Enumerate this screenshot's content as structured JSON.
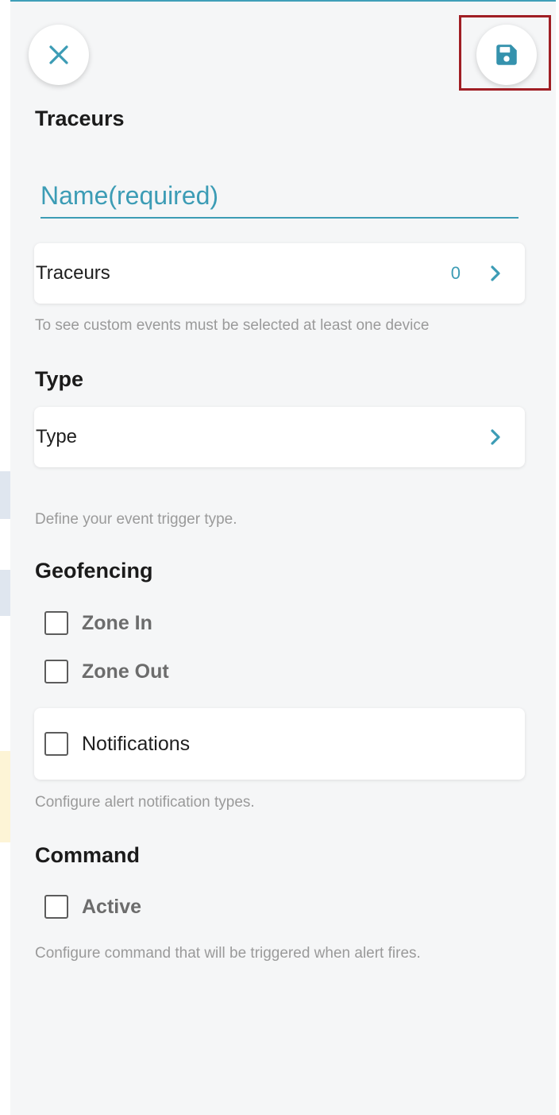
{
  "header": {
    "close_icon": "close-icon",
    "save_icon": "floppy-disk-save-icon"
  },
  "sections": {
    "trackers_heading": "Traceurs",
    "type_heading": "Type",
    "geofencing_heading": "Geofencing",
    "command_heading": "Command"
  },
  "name_input": {
    "placeholder": "Name(required)",
    "value": ""
  },
  "trackers_card": {
    "label": "Traceurs",
    "count": "0",
    "hint": "To see custom events must be selected at least one device"
  },
  "type_card": {
    "label": "Type",
    "hint": "Define your event trigger type."
  },
  "geofencing": {
    "options": [
      {
        "label": "Zone In",
        "checked": false
      },
      {
        "label": "Zone Out",
        "checked": false
      }
    ]
  },
  "notifications_card": {
    "label": "Notifications",
    "checked": false,
    "hint": "Configure alert notification types."
  },
  "command": {
    "active_label": "Active",
    "checked": false,
    "hint": "Configure command that will be triggered when alert fires."
  },
  "colors": {
    "accent": "#3c9cb5",
    "highlight": "#a01e24",
    "background": "#f5f6f7"
  }
}
